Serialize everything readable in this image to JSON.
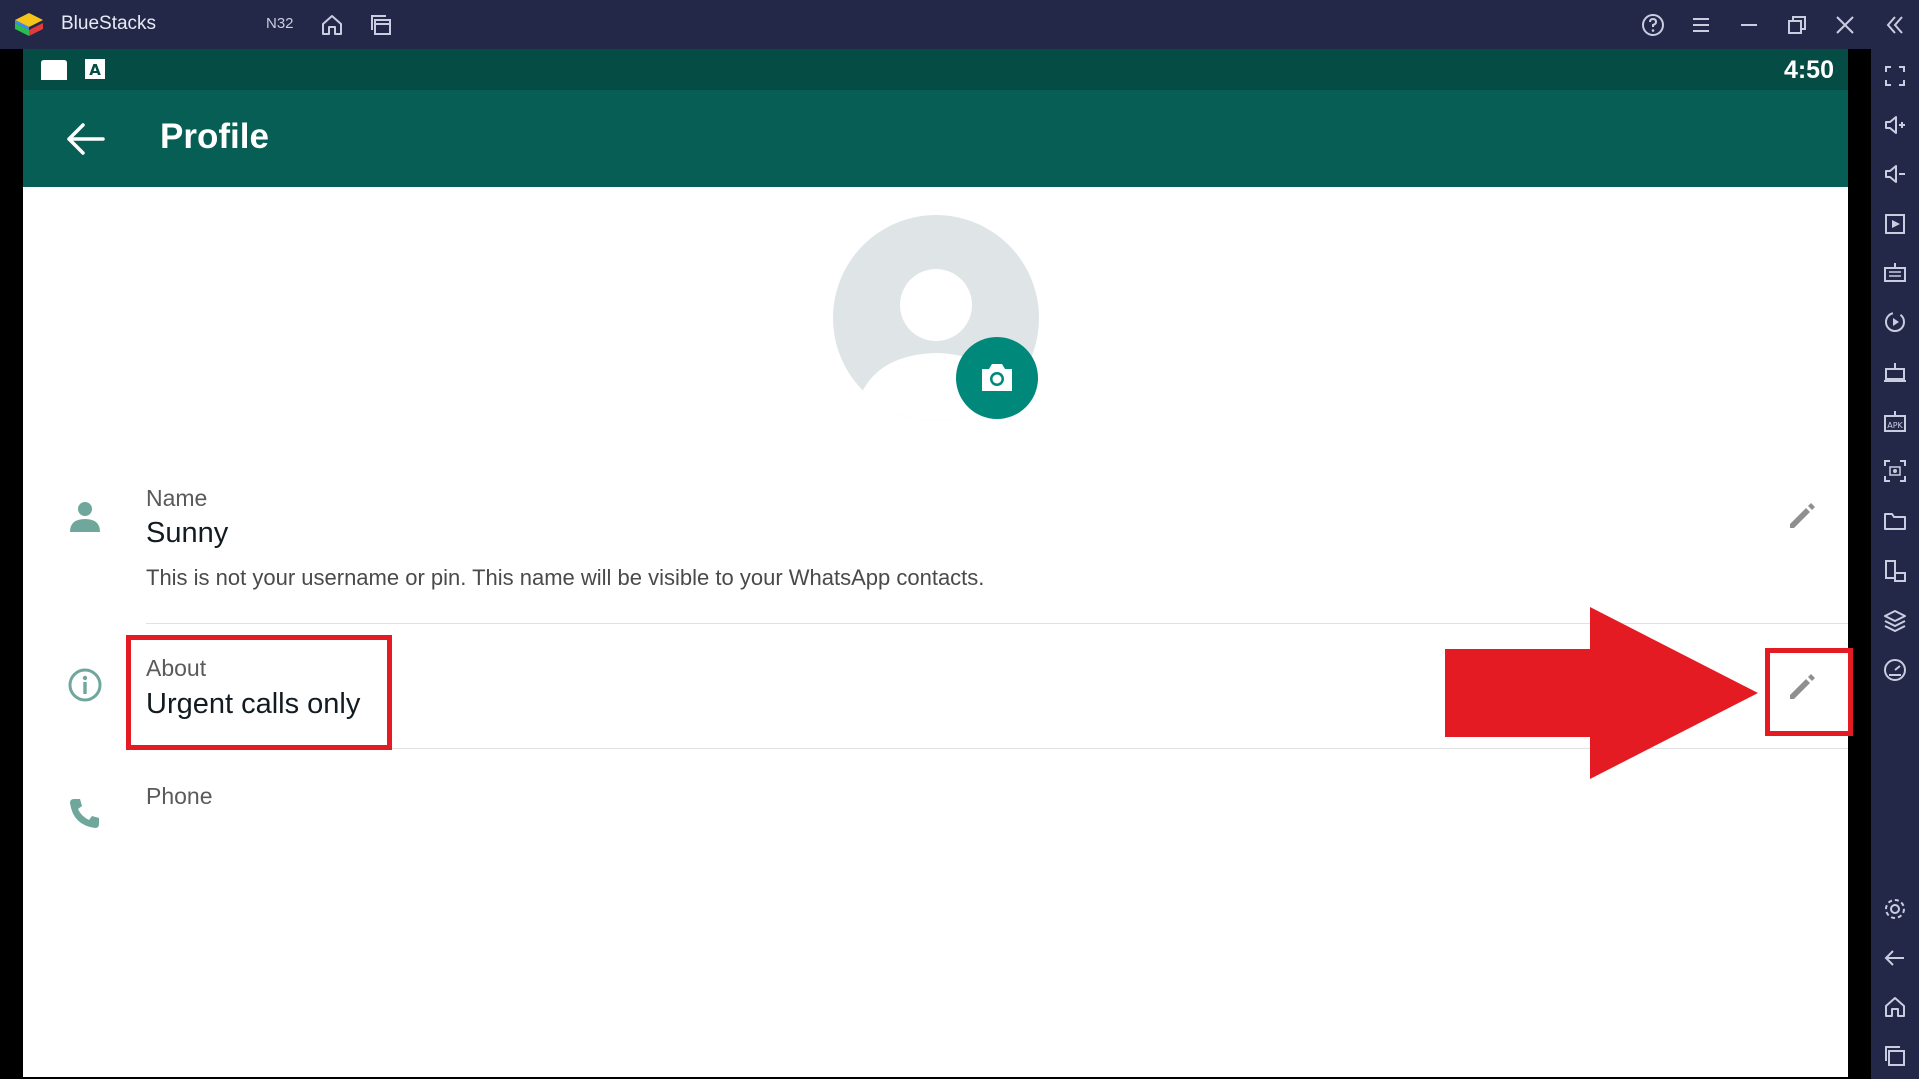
{
  "window": {
    "app_title": "BlueStacks",
    "instance": "N32"
  },
  "statusbar": {
    "clock": "4:50"
  },
  "appbar": {
    "title": "Profile"
  },
  "profile": {
    "name_label": "Name",
    "name_value": "Sunny",
    "name_hint": "This is not your username or pin. This name will be visible to your WhatsApp contacts.",
    "about_label": "About",
    "about_value": "Urgent calls only",
    "phone_label": "Phone"
  },
  "icons": {
    "titlebar": [
      "bluestacks-logo-icon",
      "home-icon",
      "multi-instance-icon",
      "help-icon",
      "menu-icon",
      "minimize-icon",
      "restore-icon",
      "close-icon",
      "collapse-sidebar-icon"
    ],
    "sidebar": [
      "fullscreen-icon",
      "volume-up-icon",
      "volume-down-icon",
      "media-icon",
      "keyboard-icon",
      "macro-icon",
      "robot-icon",
      "apk-icon",
      "screenshot-icon",
      "folder-icon",
      "rotate-icon",
      "layers-icon",
      "performance-icon",
      "settings-icon",
      "back-icon",
      "home-icon",
      "recents-icon"
    ]
  },
  "colors": {
    "titlebar_bg": "#232848",
    "status_bar_bg": "#054d44",
    "app_bar_bg": "#075e54",
    "accent": "#00897b",
    "annotation_red": "#e51b24"
  }
}
